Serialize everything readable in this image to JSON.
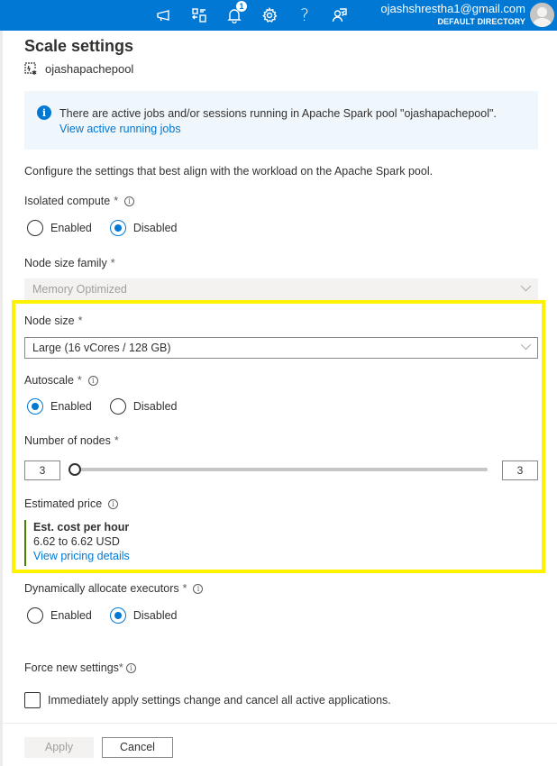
{
  "topbar": {
    "icons": [
      "feedback-icon",
      "directory-switch-icon",
      "notifications-icon",
      "settings-icon",
      "help-icon",
      "support-icon"
    ],
    "notification_count": "1",
    "user_email": "ojashshrestha1@gmail.com",
    "user_directory": "DEFAULT DIRECTORY",
    "accent_color": "#0078d4"
  },
  "panel": {
    "title": "Scale settings",
    "resource_name": "ojashapachepool"
  },
  "info_bar": {
    "message": "There are active jobs and/or sessions running in Apache Spark pool \"ojashapachepool\".",
    "link": "View active running jobs"
  },
  "description": "Configure the settings that best align with the workload on the Apache Spark pool.",
  "isolated_compute": {
    "label": "Isolated compute",
    "required": "*",
    "options": [
      "Enabled",
      "Disabled"
    ],
    "selected": "Disabled"
  },
  "node_size_family": {
    "label": "Node size family",
    "required": "*",
    "value": "Memory Optimized",
    "disabled": true
  },
  "node_size": {
    "label": "Node size",
    "required": "*",
    "value": "Large (16 vCores / 128 GB)"
  },
  "autoscale": {
    "label": "Autoscale",
    "required": "*",
    "options": [
      "Enabled",
      "Disabled"
    ],
    "selected": "Enabled"
  },
  "number_of_nodes": {
    "label": "Number of nodes",
    "required": "*",
    "min_value": "3",
    "max_value": "3"
  },
  "estimated_price": {
    "label": "Estimated price",
    "heading": "Est. cost per hour",
    "value": "6.62 to 6.62 USD",
    "link": "View pricing details"
  },
  "dynamic_executors": {
    "label": "Dynamically allocate executors",
    "required": "*",
    "options": [
      "Enabled",
      "Disabled"
    ],
    "selected": "Disabled"
  },
  "force_new_settings": {
    "label": "Force new settings",
    "required": "*",
    "checkbox_label": "Immediately apply settings change and cancel all active applications.",
    "checked": false
  },
  "footer": {
    "apply_label": "Apply",
    "cancel_label": "Cancel"
  },
  "highlight_color": "#fff200"
}
